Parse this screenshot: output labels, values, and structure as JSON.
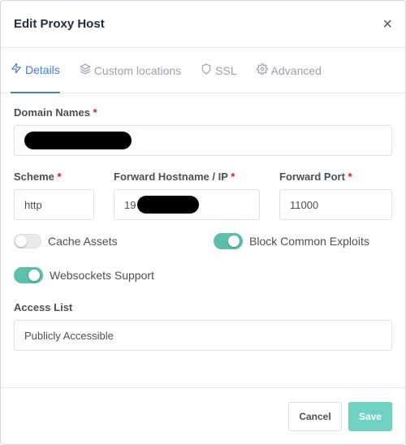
{
  "modal": {
    "title": "Edit Proxy Host",
    "close_symbol": "×"
  },
  "tabs": [
    {
      "label": "Details",
      "icon": "lightning-icon",
      "active": true
    },
    {
      "label": "Custom locations",
      "icon": "layers-icon",
      "active": false
    },
    {
      "label": "SSL",
      "icon": "shield-icon",
      "active": false
    },
    {
      "label": "Advanced",
      "icon": "gear-icon",
      "active": false
    }
  ],
  "form": {
    "domain_names": {
      "label": "Domain Names",
      "required_mark": "*"
    },
    "scheme": {
      "label": "Scheme",
      "required_mark": "*",
      "value": "http"
    },
    "forward_host": {
      "label": "Forward Hostname / IP",
      "required_mark": "*",
      "value_prefix": "19"
    },
    "forward_port": {
      "label": "Forward Port",
      "required_mark": "*",
      "value": "11000"
    },
    "cache_assets": {
      "label": "Cache Assets",
      "on": false
    },
    "block_exploits": {
      "label": "Block Common Exploits",
      "on": true
    },
    "websockets": {
      "label": "Websockets Support",
      "on": true
    },
    "access_list": {
      "label": "Access List",
      "value": "Publicly Accessible"
    }
  },
  "footer": {
    "cancel_label": "Cancel",
    "save_label": "Save"
  },
  "colors": {
    "accent": "#467fcf",
    "toggle_on": "#5bbfab",
    "save_button": "#6fd3c2",
    "required": "#cd201f"
  }
}
